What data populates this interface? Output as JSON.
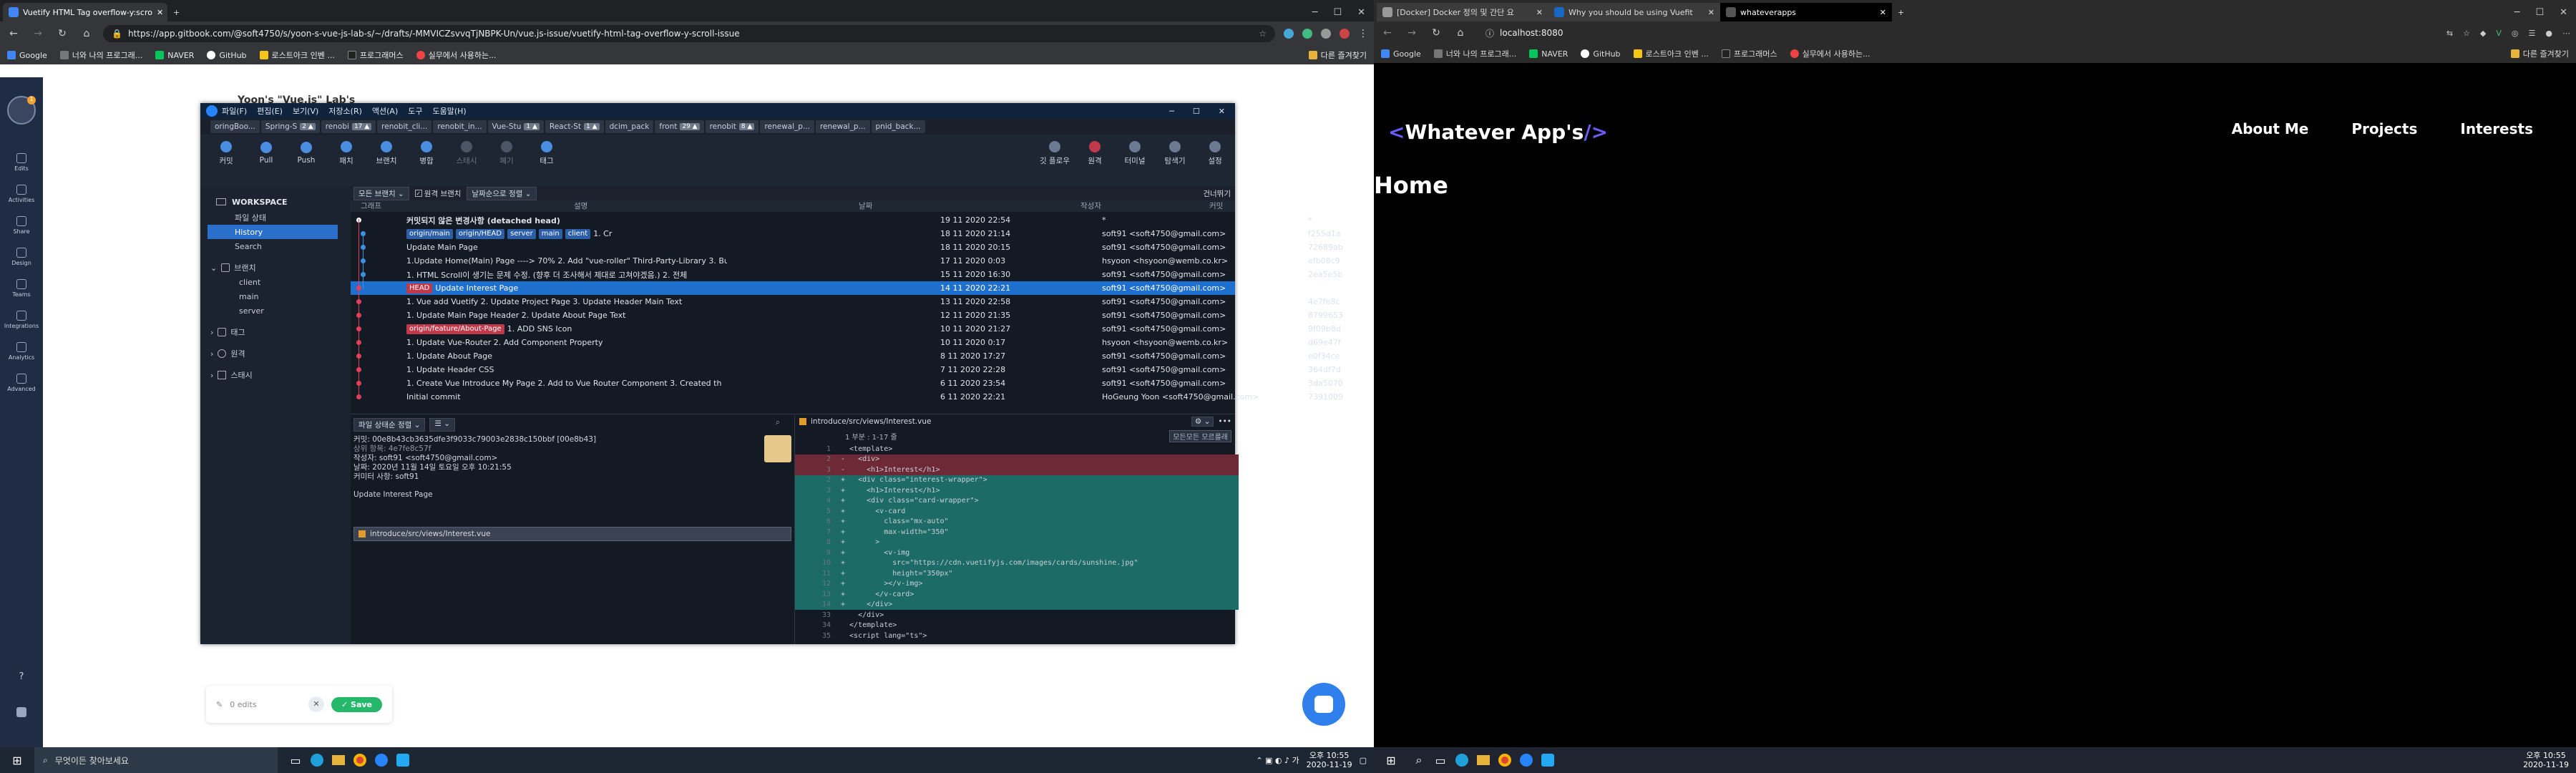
{
  "left_browser": {
    "tabs": [
      {
        "label": "Vuetify HTML Tag overflow-y:scro",
        "active": true
      }
    ],
    "url": "https://app.gitbook.com/@soft4750/s/yoon-s-vue-js-lab-s/~/drafts/-MMVICZsvvqTjNBPK-Un/vue.js-issue/vuetify-html-tag-overflow-y-scroll-issue",
    "bookmarks": [
      "Google",
      "너와 나의 프로그래...",
      "NAVER",
      "GitHub",
      "로스트아크 인벤 ...",
      "프로그래머스",
      "실무에서 사용하는..."
    ],
    "other_bookmarks": "다른 즐겨찾기"
  },
  "gitbook": {
    "side_items": [
      "Edits",
      "Activities",
      "Share",
      "Design",
      "Teams",
      "Integrations",
      "Analytics",
      "Advanced"
    ],
    "page_title": "Yoon's \"Vue.js\" Lab's",
    "edits_label": "0 edits",
    "save_label": "Save",
    "help_icon": "?"
  },
  "sourcetree": {
    "menu": [
      "파일(F)",
      "편집(E)",
      "보기(V)",
      "저장소(R)",
      "액션(A)",
      "도구",
      "도움말(H)"
    ],
    "repo_tabs": [
      {
        "label": "oringBoo...",
        "badge": ""
      },
      {
        "label": "Spring-S",
        "badge": "2 ▲"
      },
      {
        "label": "renobi",
        "badge": "17 ▲"
      },
      {
        "label": "renobit_cli...",
        "badge": ""
      },
      {
        "label": "renobit_in...",
        "badge": ""
      },
      {
        "label": "Vue-Stu",
        "badge": "1 ▲"
      },
      {
        "label": "React-St",
        "badge": "1 ▲"
      },
      {
        "label": "dcim_pack",
        "badge": ""
      },
      {
        "label": "front",
        "badge": "29 ▲"
      },
      {
        "label": "renobit",
        "badge": "8 ▲"
      },
      {
        "label": "renewal_p...",
        "badge": ""
      },
      {
        "label": "renewal_p...",
        "badge": ""
      },
      {
        "label": "pnid_back...",
        "badge": ""
      }
    ],
    "toolbar": [
      {
        "label": "커밋",
        "enabled": true
      },
      {
        "label": "Pull",
        "enabled": true
      },
      {
        "label": "Push",
        "enabled": true
      },
      {
        "label": "패치",
        "enabled": true
      },
      {
        "label": "브랜치",
        "enabled": true
      },
      {
        "label": "병합",
        "enabled": true
      },
      {
        "label": "스태시",
        "enabled": false
      },
      {
        "label": "폐기",
        "enabled": false
      },
      {
        "label": "태그",
        "enabled": true
      }
    ],
    "toolbar_right": [
      "깃 플로우",
      "원격",
      "터미널",
      "탐색기",
      "설정"
    ],
    "workspace": "WORKSPACE",
    "nav": [
      "파일 상태",
      "History",
      "Search"
    ],
    "branches_label": "브랜치",
    "branches": [
      "client",
      "main",
      "server"
    ],
    "tags_label": "태그",
    "remotes_label": "원격",
    "stashes_label": "스태시",
    "filter": {
      "branch": "모든 브랜치",
      "show_remote": "원격 브랜치",
      "sort": "날짜순으로 정렬",
      "jump": "건너뛰기"
    },
    "headers": [
      "그래프",
      "설명",
      "날짜",
      "작성자",
      "커밋"
    ],
    "commits": [
      {
        "desc": "커밋되지 않은 변경사항 (detached head)",
        "tags": [],
        "date": "19 11 2020 22:54",
        "author": "*",
        "hash": "*",
        "sel": false
      },
      {
        "desc": "1. Cr",
        "tags": [
          "origin/main",
          "origin/HEAD",
          "server",
          "main",
          "client"
        ],
        "date": "18 11 2020 21:14",
        "author": "soft91 <soft4750@gmail.com>",
        "hash": "f255d1a",
        "sel": false
      },
      {
        "desc": "Update Main Page",
        "tags": [],
        "date": "18 11 2020 20:15",
        "author": "soft91 <soft4750@gmail.com>",
        "hash": "72689ab",
        "sel": false
      },
      {
        "desc": "1.Update Home(Main) Page ----> 70% 2. Add \"vue-roller\" Third-Party-Library 3. Bu",
        "tags": [],
        "date": "17 11 2020 0:03",
        "author": "hsyoon <hsyoon@wemb.co.kr>",
        "hash": "efb08c9",
        "sel": false
      },
      {
        "desc": "1. HTML Scroll이 생기는 문제 수정. (향후 더 조사해서 제대로 고쳐야겠음.) 2. 전체",
        "tags": [],
        "date": "15 11 2020 16:30",
        "author": "soft91 <soft4750@gmail.com>",
        "hash": "2ea5e5b",
        "sel": false
      },
      {
        "desc": "Update Interest Page",
        "tags": [
          "HEAD"
        ],
        "date": "14 11 2020 22:21",
        "author": "soft91 <soft4750@gmail.com>",
        "hash": "00e8b43",
        "sel": true
      },
      {
        "desc": "1. Vue add Vuetify 2. Update Project Page 3. Update Header Main Text",
        "tags": [],
        "date": "13 11 2020 22:58",
        "author": "soft91 <soft4750@gmail.com>",
        "hash": "4e7fe8c",
        "sel": false
      },
      {
        "desc": "1. Update Main Page Header 2. Update About Page Text",
        "tags": [],
        "date": "12 11 2020 21:35",
        "author": "soft91 <soft4750@gmail.com>",
        "hash": "8799653",
        "sel": false
      },
      {
        "desc": "1. ADD SNS Icon",
        "tags": [
          "origin/feature/About-Page"
        ],
        "date": "10 11 2020 21:27",
        "author": "soft91 <soft4750@gmail.com>",
        "hash": "9f09b8d",
        "sel": false
      },
      {
        "desc": "1. Update Vue-Router 2. Add Component Property",
        "tags": [],
        "date": "10 11 2020 0:17",
        "author": "hsyoon <hsyoon@wemb.co.kr>",
        "hash": "d69e47f",
        "sel": false
      },
      {
        "desc": "1. Update About Page",
        "tags": [],
        "date": "8 11 2020 17:27",
        "author": "soft91 <soft4750@gmail.com>",
        "hash": "e0f34ce",
        "sel": false
      },
      {
        "desc": "1. Update Header CSS",
        "tags": [],
        "date": "7 11 2020 22:28",
        "author": "soft91 <soft4750@gmail.com>",
        "hash": "364df7d",
        "sel": false
      },
      {
        "desc": "1. Create Vue Introduce My Page 2. Add to Vue Router Component 3. Created th",
        "tags": [],
        "date": "6 11 2020 23:54",
        "author": "soft91 <soft4750@gmail.com>",
        "hash": "3da5070",
        "sel": false
      },
      {
        "desc": "Initial commit",
        "tags": [],
        "date": "6 11 2020 22:21",
        "author": "HoGeung Yoon <soft4750@gmail.com>",
        "hash": "7391009",
        "sel": false
      }
    ],
    "detail": {
      "file_filter": "파일 상태순 정렬",
      "commit_line": "커밋: 00e8b43cb3635dfe3f9033c79003e2838c150bbf [00e8b43]",
      "parent_line": "상위 항목: 4e7fe8c57f",
      "author_line": "작성자: soft91 <soft4750@gmail.com>",
      "date_line": "날짜: 2020년 11월 14일 토요일 오후 10:21:55",
      "committer_line": "커미터 사항: soft91",
      "message": "Update Interest Page",
      "file": "introduce/src/views/Interest.vue"
    },
    "diff": {
      "path": "introduce/src/views/Interest.vue",
      "hunk": "1 부분 : 1-17 줄",
      "discard_btn": "모든모든 모르를래",
      "lines": [
        {
          "n": "1",
          "t": "  <template>",
          "k": ""
        },
        {
          "n": "2",
          "t": "-   <div>",
          "k": "rm"
        },
        {
          "n": "3",
          "t": "-     <h1>Interest</h1>",
          "k": "rm"
        },
        {
          "n": "2",
          "t": "+   <div class=\"interest-wrapper\">",
          "k": "add"
        },
        {
          "n": "3",
          "t": "+     <h1>Interest</h1>",
          "k": "add"
        },
        {
          "n": "4",
          "t": "+     <div class=\"card-wrapper\">",
          "k": "add"
        },
        {
          "n": "5",
          "t": "+       <v-card",
          "k": "add"
        },
        {
          "n": "6",
          "t": "+         class=\"mx-auto\"",
          "k": "add"
        },
        {
          "n": "7",
          "t": "+         max-width=\"350\"",
          "k": "add"
        },
        {
          "n": "8",
          "t": "+       >",
          "k": "add"
        },
        {
          "n": "9",
          "t": "+         <v-img",
          "k": "add"
        },
        {
          "n": "10",
          "t": "+           src=\"https://cdn.vuetifyjs.com/images/cards/sunshine.jpg\"",
          "k": "add"
        },
        {
          "n": "11",
          "t": "+           height=\"350px\"",
          "k": "add"
        },
        {
          "n": "12",
          "t": "+         ></v-img>",
          "k": "add"
        },
        {
          "n": "13",
          "t": "+       </v-card>",
          "k": "add"
        },
        {
          "n": "14",
          "t": "+     </div>",
          "k": "add"
        },
        {
          "n": "33",
          "t": "    </div>",
          "k": ""
        },
        {
          "n": "34",
          "t": "  </template>",
          "k": ""
        },
        {
          "n": "35",
          "t": "  <script lang=\"ts\">",
          "k": ""
        }
      ]
    }
  },
  "right_browser": {
    "tabs": [
      {
        "label": "[Docker] Docker 정의 및 간단 요",
        "active": false
      },
      {
        "label": "Why you should be using Vuefit",
        "active": false
      },
      {
        "label": "whateverapps",
        "active": true
      }
    ],
    "url": "localhost:8080",
    "bookmarks": [
      "Google",
      "너와 나의 프로그래...",
      "NAVER",
      "GitHub",
      "로스트아크 인벤 ...",
      "프로그래머스",
      "실무에서 사용하는..."
    ],
    "other_bookmarks": "다른 즐겨찾기"
  },
  "app": {
    "logo_open": "<",
    "logo_text": "Whatever App's",
    "logo_close": "/>",
    "nav": [
      "About Me",
      "Projects",
      "Interests"
    ],
    "heading": "Home"
  },
  "taskbar_left": {
    "search": "무엇이든 찾아보세요",
    "time": "오후 10:55",
    "date": "2020-11-19"
  },
  "taskbar_right": {
    "time": "오후 10:55",
    "date": "2020-11-19"
  },
  "colors": {
    "accent": "#1f6fcf",
    "vue_green": "#42b883",
    "logo_purple": "#6a5cf5"
  }
}
